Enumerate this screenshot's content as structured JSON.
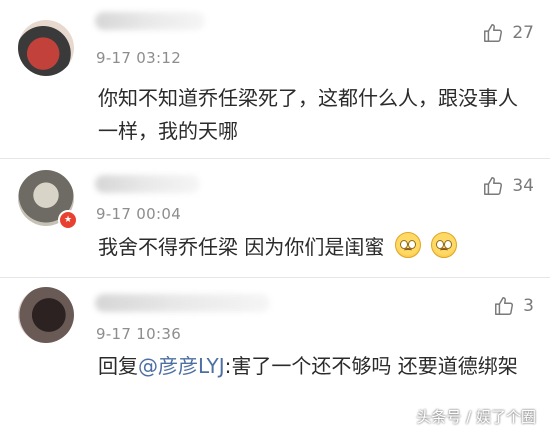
{
  "comments": [
    {
      "time": "9-17 03:12",
      "likes": "27",
      "text": "你知不知道乔任梁死了，这都什么人，跟没事人一样，我的天哪"
    },
    {
      "time": "9-17 00:04",
      "likes": "34",
      "text": "我舍不得乔任梁  因为你们是闺蜜",
      "emojis": [
        "sad-face-icon",
        "sad-face-icon"
      ]
    },
    {
      "time": "9-17 10:36",
      "likes": "3",
      "reply_prefix": "回复",
      "mention": "@彦彦LYJ",
      "text": ":害了一个还不够吗 还要道德绑架"
    }
  ],
  "watermark": "头条号 / 娱了个圈",
  "colors": {
    "mention": "#4d6fa3",
    "time": "#8d8d8d",
    "divider": "#e6e6e6"
  }
}
